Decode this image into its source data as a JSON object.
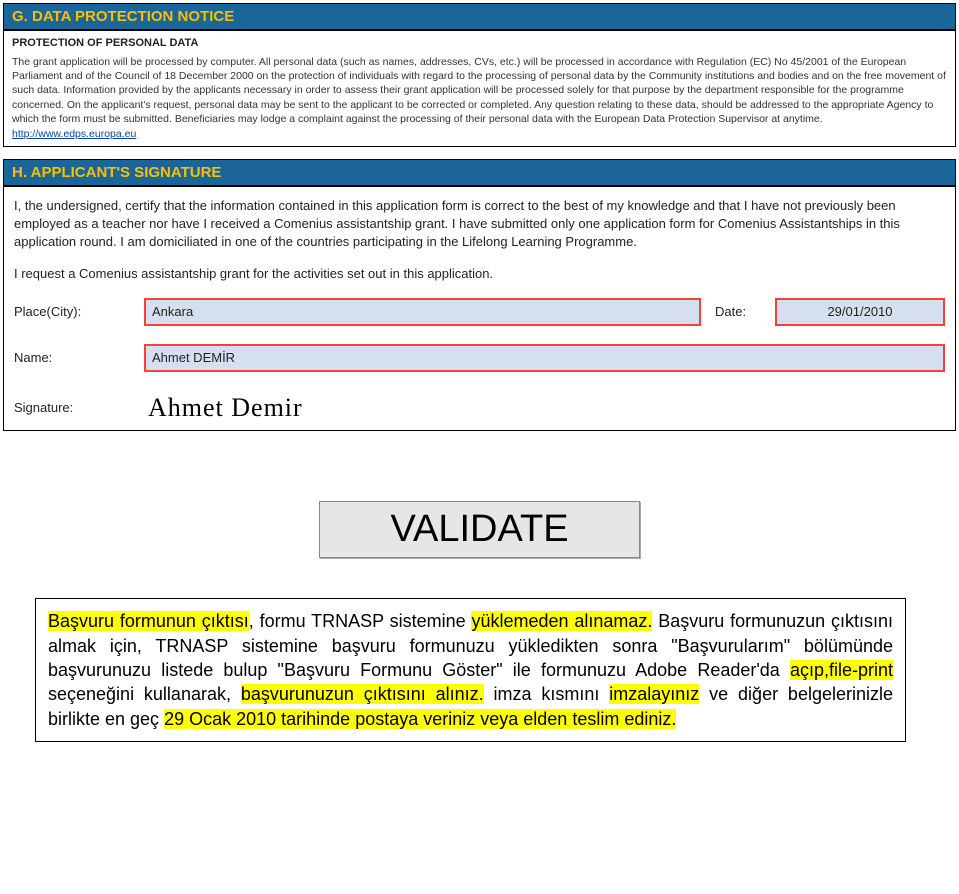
{
  "sectionG": {
    "header": "G. DATA PROTECTION NOTICE",
    "title": "PROTECTION OF PERSONAL DATA",
    "body": "The grant application will be processed by computer. All personal data (such as names, addresses, CVs, etc.) will be processed in accordance with Regulation (EC) No 45/2001 of the European Parliament and of the Council of 18 December 2000 on the protection of individuals with regard to the processing of personal data by the Community institutions and bodies and on the free movement of such data. Information provided by the applicants necessary in order to assess their grant application will be processed solely for that purpose by the department responsible for the programme concerned. On the applicant's request, personal data may be sent to the applicant to be corrected or completed. Any question relating to these data, should be addressed to the appropriate Agency to which the form must be submitted. Beneficiaries may lodge a complaint against the processing of their personal data with the European Data Protection Supervisor at anytime.",
    "link": "http://www.edps.europa.eu"
  },
  "sectionH": {
    "header": "H. APPLICANT'S SIGNATURE",
    "para1": "I, the undersigned, certify that the information contained in this application form is correct to the best of my knowledge and that I have not previously been employed as a teacher nor have I received a Comenius assistantship grant. I have submitted only one application form for Comenius Assistantships in this application round. I am domiciliated in one of the countries participating in the Lifelong Learning Programme.",
    "para2": "I request a Comenius assistantship grant for the activities set out in this application.",
    "labels": {
      "place": "Place(City):",
      "date": "Date:",
      "name": "Name:",
      "signature": "Signature:"
    },
    "values": {
      "place": "Ankara",
      "date": "29/01/2010",
      "name": "Ahmet DEMİR",
      "signature": "Ahmet Demir"
    }
  },
  "validate": {
    "label": "VALIDATE"
  },
  "instruction": {
    "s1a": "Başvuru formunun çıktısı",
    "s1b": ", formu TRNASP sistemine ",
    "s1c": "yüklemeden alınamaz.",
    "s2a": " Başvuru formunuzun çıktısını almak için, TRNASP sistemine başvuru formunuzu yükledikten sonra \"Başvurularım\" bölümünde başvurunuzu listede bulup \"Başvuru Formunu Göster\" ile formunuzu Adobe Reader'da ",
    "s2b": "açıp,file-print",
    "s2c": " seçeneğini kullanarak, ",
    "s2d": "başvurunuzun çıktısını alınız.",
    "s3a": " imza kısmını ",
    "s3b": "imzalayınız",
    "s3c": " ve diğer belgelerinizle birlikte en geç ",
    "s3d": "29 Ocak 2010 tarihinde postaya veriniz veya elden teslim ediniz."
  }
}
